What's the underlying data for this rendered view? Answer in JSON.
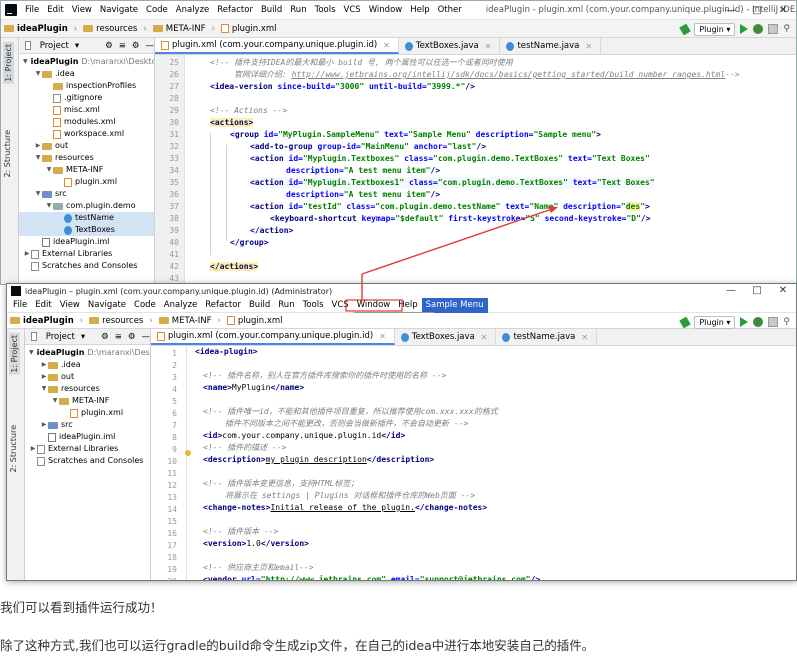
{
  "window1": {
    "menu": [
      "File",
      "Edit",
      "View",
      "Navigate",
      "Code",
      "Analyze",
      "Refactor",
      "Build",
      "Run",
      "Tools",
      "VCS",
      "Window",
      "Help",
      "Other"
    ],
    "title": "ideaPlugin - plugin.xml (com.your.company.unique.plugin.id) - IntelliJ IDEA - Administrator",
    "breadcrumbs": [
      "ideaPlugin",
      "resources",
      "META-INF",
      "plugin.xml"
    ],
    "run_config": "Plugin",
    "project_panel_title": "Project",
    "left_tabs": [
      "1: Project",
      "2: Structure"
    ],
    "tree": [
      {
        "label": "ideaPlugin",
        "sub": "D:\\maranxi\\Desktop\\",
        "depth": 0,
        "icon": "folder",
        "arrow": "down",
        "bold": true
      },
      {
        "label": ".idea",
        "depth": 1,
        "icon": "folder",
        "arrow": "down"
      },
      {
        "label": "inspectionProfiles",
        "depth": 2,
        "icon": "folder",
        "arrow": ""
      },
      {
        "label": ".gitignore",
        "depth": 2,
        "icon": "txt",
        "arrow": ""
      },
      {
        "label": "misc.xml",
        "depth": 2,
        "icon": "xml",
        "arrow": ""
      },
      {
        "label": "modules.xml",
        "depth": 2,
        "icon": "xml",
        "arrow": ""
      },
      {
        "label": "workspace.xml",
        "depth": 2,
        "icon": "xml",
        "arrow": ""
      },
      {
        "label": "out",
        "depth": 1,
        "icon": "folder",
        "arrow": "right"
      },
      {
        "label": "resources",
        "depth": 1,
        "icon": "folder",
        "arrow": "down"
      },
      {
        "label": "META-INF",
        "depth": 2,
        "icon": "folder",
        "arrow": "down"
      },
      {
        "label": "plugin.xml",
        "depth": 3,
        "icon": "xml",
        "arrow": ""
      },
      {
        "label": "src",
        "depth": 1,
        "icon": "folder-blue",
        "arrow": "down"
      },
      {
        "label": "com.plugin.demo",
        "depth": 2,
        "icon": "folder-gray",
        "arrow": "down"
      },
      {
        "label": "testName",
        "depth": 3,
        "icon": "class",
        "arrow": "",
        "selected": true
      },
      {
        "label": "TextBoxes",
        "depth": 3,
        "icon": "class",
        "arrow": "",
        "selected": true
      },
      {
        "label": "ideaPlugin.iml",
        "depth": 1,
        "icon": "iml",
        "arrow": ""
      },
      {
        "label": "External Libraries",
        "depth": 0,
        "icon": "lib",
        "arrow": "right"
      },
      {
        "label": "Scratches and Consoles",
        "depth": 0,
        "icon": "scratch",
        "arrow": ""
      }
    ],
    "tabs": [
      "plugin.xml (com.your.company.unique.plugin.id)",
      "TextBoxes.java",
      "testName.java"
    ],
    "line_numbers": [
      "25",
      "26",
      "27",
      "28",
      "29",
      "30",
      "31",
      "32",
      "33",
      "34",
      "35",
      "36",
      "37",
      "38",
      "39",
      "40",
      "41",
      "42",
      "43"
    ]
  },
  "window2": {
    "title": "ideaPlugin – plugin.xml (com.your.company.unique.plugin.id) (Administrator)",
    "menu": [
      "File",
      "Edit",
      "View",
      "Navigate",
      "Code",
      "Analyze",
      "Refactor",
      "Build",
      "Run",
      "Tools",
      "VCS",
      "Window",
      "Help",
      "Sample Menu"
    ],
    "dropdown": [
      {
        "label": "Text Boxes",
        "shortcut": ""
      },
      {
        "label": "Text Boxes",
        "shortcut": ""
      },
      {
        "label": "Name",
        "shortcut": "S, D"
      }
    ],
    "breadcrumbs": [
      "ideaPlugin",
      "resources",
      "META-INF",
      "plugin.xml"
    ],
    "run_config": "Plugin",
    "project_panel_title": "Project",
    "left_tabs": [
      "1: Project",
      "2: Structure"
    ],
    "tree": [
      {
        "label": "ideaPlugin",
        "sub": "D:\\maranxi\\Deskt",
        "depth": 0,
        "icon": "folder",
        "arrow": "down",
        "bold": true
      },
      {
        "label": ".idea",
        "depth": 1,
        "icon": "folder",
        "arrow": "right"
      },
      {
        "label": "out",
        "depth": 1,
        "icon": "folder",
        "arrow": "right"
      },
      {
        "label": "resources",
        "depth": 1,
        "icon": "folder",
        "arrow": "down"
      },
      {
        "label": "META-INF",
        "depth": 2,
        "icon": "folder",
        "arrow": "down"
      },
      {
        "label": "plugin.xml",
        "depth": 3,
        "icon": "xml",
        "arrow": ""
      },
      {
        "label": "src",
        "depth": 1,
        "icon": "folder-blue",
        "arrow": "right"
      },
      {
        "label": "ideaPlugin.iml",
        "depth": 1,
        "icon": "iml",
        "arrow": ""
      },
      {
        "label": "External Libraries",
        "depth": 0,
        "icon": "lib",
        "arrow": "right"
      },
      {
        "label": "Scratches and Consoles",
        "depth": 0,
        "icon": "scratch",
        "arrow": ""
      }
    ],
    "tabs": [
      "plugin.xml (com.your.company.unique.plugin.id)",
      "TextBoxes.java",
      "testName.java"
    ],
    "line_numbers": [
      "1",
      "2",
      "3",
      "4",
      "5",
      "6",
      "7",
      "8",
      "9",
      "10",
      "11",
      "12",
      "13",
      "14",
      "15",
      "16",
      "17",
      "18",
      "19",
      "20",
      "21"
    ]
  },
  "article": {
    "p1": "我们可以看到插件运行成功！",
    "p2": "除了这种方式,我们也可以运行gradle的build命令生成zip文件，在自己的idea中进行本地安装自己的插件。"
  },
  "colors": {
    "menu_highlight": "#2f65ca",
    "arrow": "#e53935",
    "selection": "#d4e2f5"
  }
}
